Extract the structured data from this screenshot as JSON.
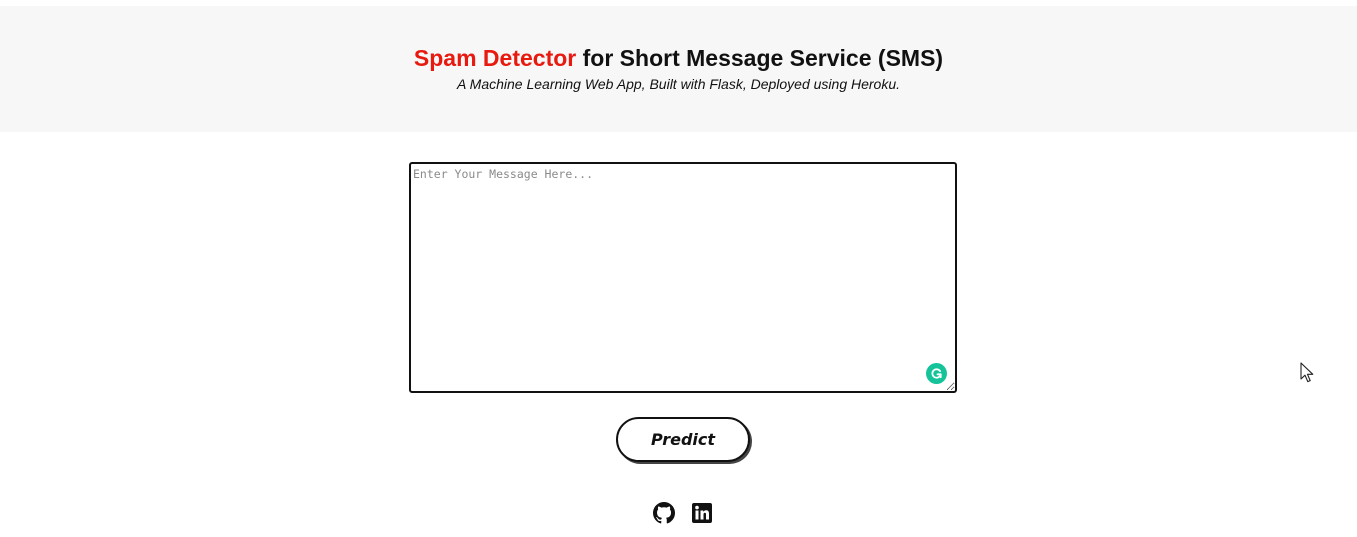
{
  "header": {
    "title_accent": "Spam Detector",
    "title_rest": " for Short Message Service (SMS)",
    "subtitle": "A Machine Learning Web App, Built with Flask, Deployed using Heroku."
  },
  "form": {
    "message_placeholder": "Enter Your Message Here...",
    "message_value": "",
    "predict_label": "Predict"
  },
  "footer": {
    "links": [
      {
        "icon": "github-icon"
      },
      {
        "icon": "linkedin-icon"
      }
    ]
  },
  "colors": {
    "accent": "#e8190f",
    "header_bg": "#f7f7f7",
    "grammarly": "#15c39a"
  }
}
